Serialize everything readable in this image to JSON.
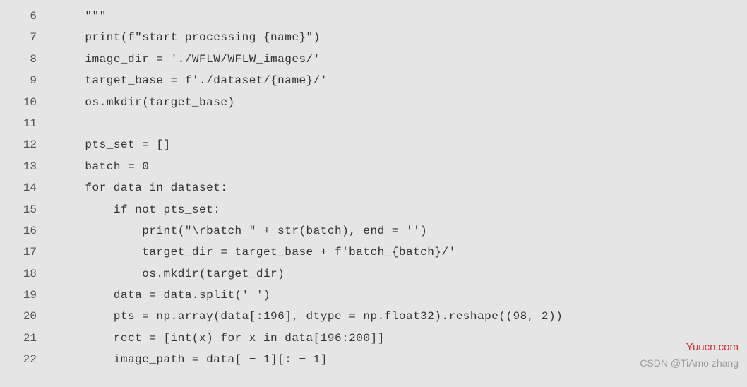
{
  "code": {
    "lines": [
      {
        "number": 6,
        "text": "    \"\"\""
      },
      {
        "number": 7,
        "text": "    print(f\"start processing {name}\")"
      },
      {
        "number": 8,
        "text": "    image_dir = './WFLW/WFLW_images/'"
      },
      {
        "number": 9,
        "text": "    target_base = f'./dataset/{name}/'"
      },
      {
        "number": 10,
        "text": "    os.mkdir(target_base)"
      },
      {
        "number": 11,
        "text": ""
      },
      {
        "number": 12,
        "text": "    pts_set = []"
      },
      {
        "number": 13,
        "text": "    batch = 0"
      },
      {
        "number": 14,
        "text": "    for data in dataset:"
      },
      {
        "number": 15,
        "text": "        if not pts_set:"
      },
      {
        "number": 16,
        "text": "            print(\"\\rbatch \" + str(batch), end = '')"
      },
      {
        "number": 17,
        "text": "            target_dir = target_base + f'batch_{batch}/'"
      },
      {
        "number": 18,
        "text": "            os.mkdir(target_dir)"
      },
      {
        "number": 19,
        "text": "        data = data.split(' ')"
      },
      {
        "number": 20,
        "text": "        pts = np.array(data[:196], dtype = np.float32).reshape((98, 2))"
      },
      {
        "number": 21,
        "text": "        rect = [int(x) for x in data[196:200]]"
      },
      {
        "number": 22,
        "text": "        image_path = data[ − 1][: − 1]"
      }
    ]
  },
  "watermarks": {
    "red": "Yuucn.com",
    "grey": "CSDN @TiAmo zhang"
  }
}
